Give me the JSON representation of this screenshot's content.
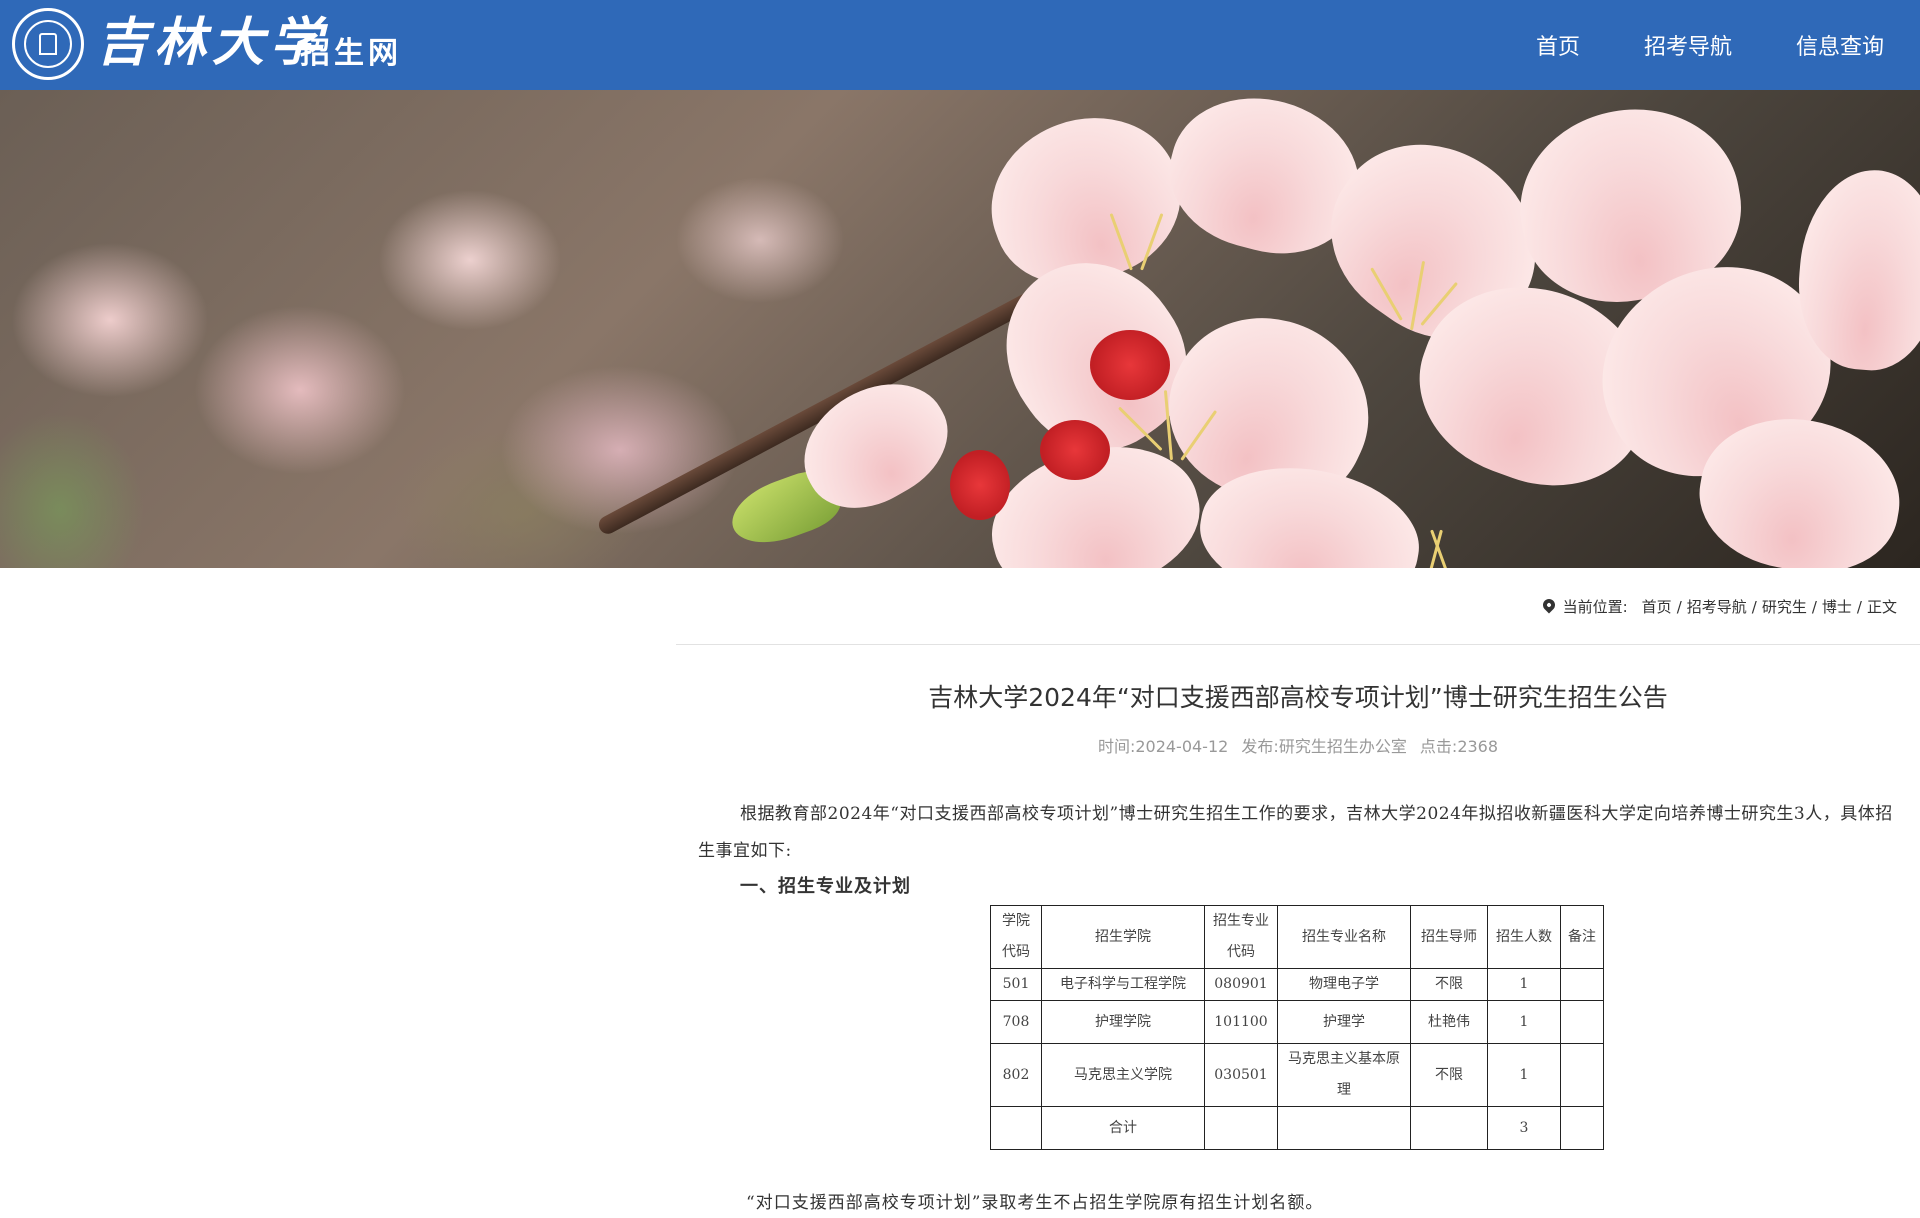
{
  "header": {
    "logo_name": "吉林大学",
    "logo_sub": "招生网",
    "nav": [
      "首页",
      "招考导航",
      "信息查询"
    ]
  },
  "breadcrumb": {
    "label": "当前位置:",
    "items": [
      "首页",
      "招考导航",
      "研究生",
      "博士",
      "正文"
    ]
  },
  "article": {
    "title": "吉林大学2024年“对口支援西部高校专项计划”博士研究生招生公告",
    "meta": {
      "time": "时间:2024-04-12",
      "publisher": "发布:研究生招生办公室",
      "clicks": "点击:2368"
    },
    "intro": "根据教育部2024年“对口支援西部高校专项计划”博士研究生招生工作的要求，吉林大学2024年拟招收新疆医科大学定向培养博士研究生3人，具体招生事宜如下:",
    "section1_heading": "一、招生专业及计划",
    "table": {
      "headers": [
        "学院代码",
        "招生学院",
        "招生专业代码",
        "招生专业名称",
        "招生导师",
        "招生人数",
        "备注"
      ],
      "rows": [
        [
          "501",
          "电子科学与工程学院",
          "080901",
          "物理电子学",
          "不限",
          "1",
          ""
        ],
        [
          "708",
          "护理学院",
          "101100",
          "护理学",
          "杜艳伟",
          "1",
          ""
        ],
        [
          "802",
          "马克思主义学院",
          "030501",
          "马克思主义基本原理",
          "不限",
          "1",
          ""
        ],
        [
          "",
          "合计",
          "",
          "",
          "",
          "3",
          ""
        ]
      ]
    },
    "footnote": "“对口支援西部高校专项计划”录取考生不占招生学院原有招生计划名额。"
  },
  "colors": {
    "header_bg": "#2f69b8",
    "text": "#333333",
    "meta_text": "#999999"
  }
}
